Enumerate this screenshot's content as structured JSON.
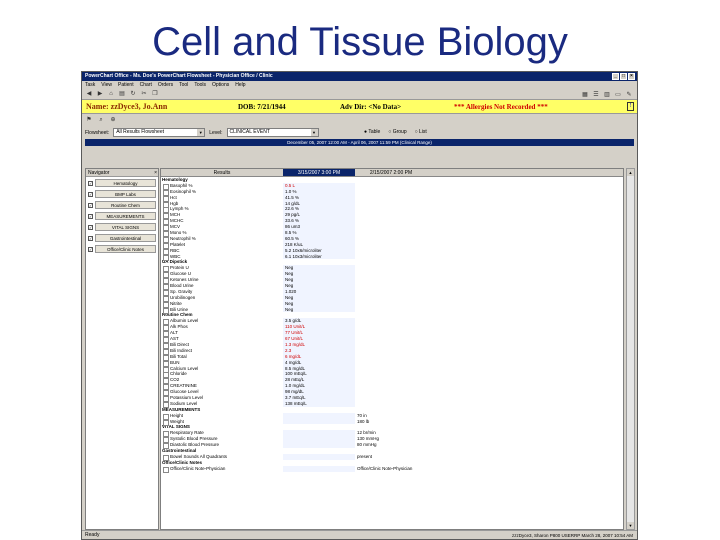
{
  "slide_title": "Cell and Tissue Biology",
  "window": {
    "title": "PowerChart Office - Ms. Doe's PowerChart Flowsheet - Physician Office / Clinic"
  },
  "menu": [
    "Task",
    "View",
    "Patient",
    "Chart",
    "Orders",
    "Tool",
    "Tools",
    "Options",
    "Help"
  ],
  "banner": {
    "name": "Name: zzDyce3, Jo.Ann",
    "dob": "DOB: 7/21/1944",
    "adv_dir": "Adv Dir: <No Data>",
    "allergies": "*** Allergies Not Recorded ***"
  },
  "filters": {
    "flowsheet_label": "Flowsheet:",
    "flowsheet_value": "All Results Flowsheet",
    "level_label": "Level:",
    "level_value": "CLINICAL EVENT",
    "radio_table": "Table",
    "radio_group": "Group",
    "radio_list": "List"
  },
  "range": "December 05, 2007 12:00 AM - April 06, 2007 11:59 PM (Clinical Range)",
  "navigator": {
    "title": "Navigator",
    "close": "×",
    "items": [
      "Hematology",
      "BMP Labs",
      "Routine Chem",
      "MEASUREMENTS",
      "VITAL SIGNS",
      "Gastrointestinal",
      "Office/Clinic Notes"
    ]
  },
  "grid": {
    "col_results": "Results",
    "col_date1": "3/15/2007 3:00 PM",
    "col_date2": "2/15/2007 2:00 PM",
    "sections": [
      {
        "title": "Hematology",
        "rows": [
          [
            "Basophil %",
            "0.5 L",
            ""
          ],
          [
            "Eosinophil %",
            "1.0 %",
            ""
          ],
          [
            "Hct",
            "41.5 %",
            ""
          ],
          [
            "Hgb",
            "14 g/dL",
            ""
          ],
          [
            "Lymph %",
            "22.6 %",
            ""
          ],
          [
            "MCH",
            "29 pg/L",
            ""
          ],
          [
            "MCHC",
            "33.6 %",
            ""
          ],
          [
            "MCV",
            "86 um3",
            ""
          ],
          [
            "Mono %",
            "8.5 %",
            ""
          ],
          [
            "Neutrophil %",
            "60.5 %",
            ""
          ],
          [
            "Platelet",
            "218 K/uL",
            ""
          ],
          [
            "RBC",
            "5.2 10x6/microliter",
            ""
          ],
          [
            "WBC",
            "6.1 10x3/microliter",
            ""
          ]
        ]
      },
      {
        "title": "UA Dipstick",
        "rows": [
          [
            "Protein U",
            "Neg",
            ""
          ],
          [
            "Glucose U",
            "Neg",
            ""
          ],
          [
            "Ketones Urine",
            "Neg",
            ""
          ],
          [
            "Blood Urine",
            "Neg",
            ""
          ],
          [
            "Sp. Gravity",
            "1.020",
            ""
          ],
          [
            "Urobilinogen",
            "Neg",
            ""
          ],
          [
            "Nitrite",
            "Neg",
            ""
          ],
          [
            "Bili Urine",
            "Neg",
            ""
          ]
        ]
      },
      {
        "title": "Routine Chem",
        "rows": [
          [
            "Albumin Level",
            "3.5 g/dL",
            ""
          ],
          [
            "Alk Phos",
            "110 Unit/L",
            ""
          ],
          [
            "ALT",
            "77 Unit/L",
            ""
          ],
          [
            "AST",
            "67 Unit/L",
            ""
          ],
          [
            "Bili Direct",
            "1.3 mg/dL",
            ""
          ],
          [
            "Bili Indirect",
            "2.3",
            ""
          ],
          [
            "Bili Total",
            "6 mg/dL",
            ""
          ],
          [
            "BUN",
            "4 mg/dL",
            ""
          ],
          [
            "Calcium Level",
            "8.5 mg/dL",
            ""
          ],
          [
            "Chloride",
            "100 mEq/L",
            ""
          ],
          [
            "CO2",
            "28 mEq/L",
            ""
          ],
          [
            "CREATININE",
            "1.0 mg/dL",
            ""
          ],
          [
            "Glucose Level",
            "98 mg/dL",
            ""
          ],
          [
            "Potassium Level",
            "3.7 mEq/L",
            ""
          ],
          [
            "Sodium Level",
            "138 mEq/L",
            ""
          ]
        ]
      },
      {
        "title": "MEASUREMENTS",
        "rows": [
          [
            "Height",
            "",
            "70 in"
          ],
          [
            "Weight",
            "",
            "180 lb"
          ]
        ]
      },
      {
        "title": "VITAL SIGNS",
        "rows": [
          [
            "Respiratory Rate",
            "",
            "12 br/min"
          ],
          [
            "Systolic Blood Pressure",
            "",
            "130 mmHg"
          ],
          [
            "Diastolic Blood Pressure",
            "",
            "80 mmHg"
          ]
        ]
      },
      {
        "title": "Gastrointestinal",
        "rows": [
          [
            "Bowel Sounds All Quadrants",
            "",
            "present"
          ]
        ]
      },
      {
        "title": "Office/Clinic Notes",
        "rows": [
          [
            "Office/Clinic Note-Physician",
            "",
            "Office/Clinic Note-Physician"
          ]
        ]
      }
    ]
  },
  "status": {
    "left": "Ready",
    "right": "zzzDyce3, Sharon   P800   USERRP   March 28, 2007   10:54 AM"
  },
  "colors": {
    "title_blue": "#1a2a80",
    "window_blue": "#0a246a",
    "banner_yellow": "#ffff66",
    "alert_red": "#d00000"
  }
}
